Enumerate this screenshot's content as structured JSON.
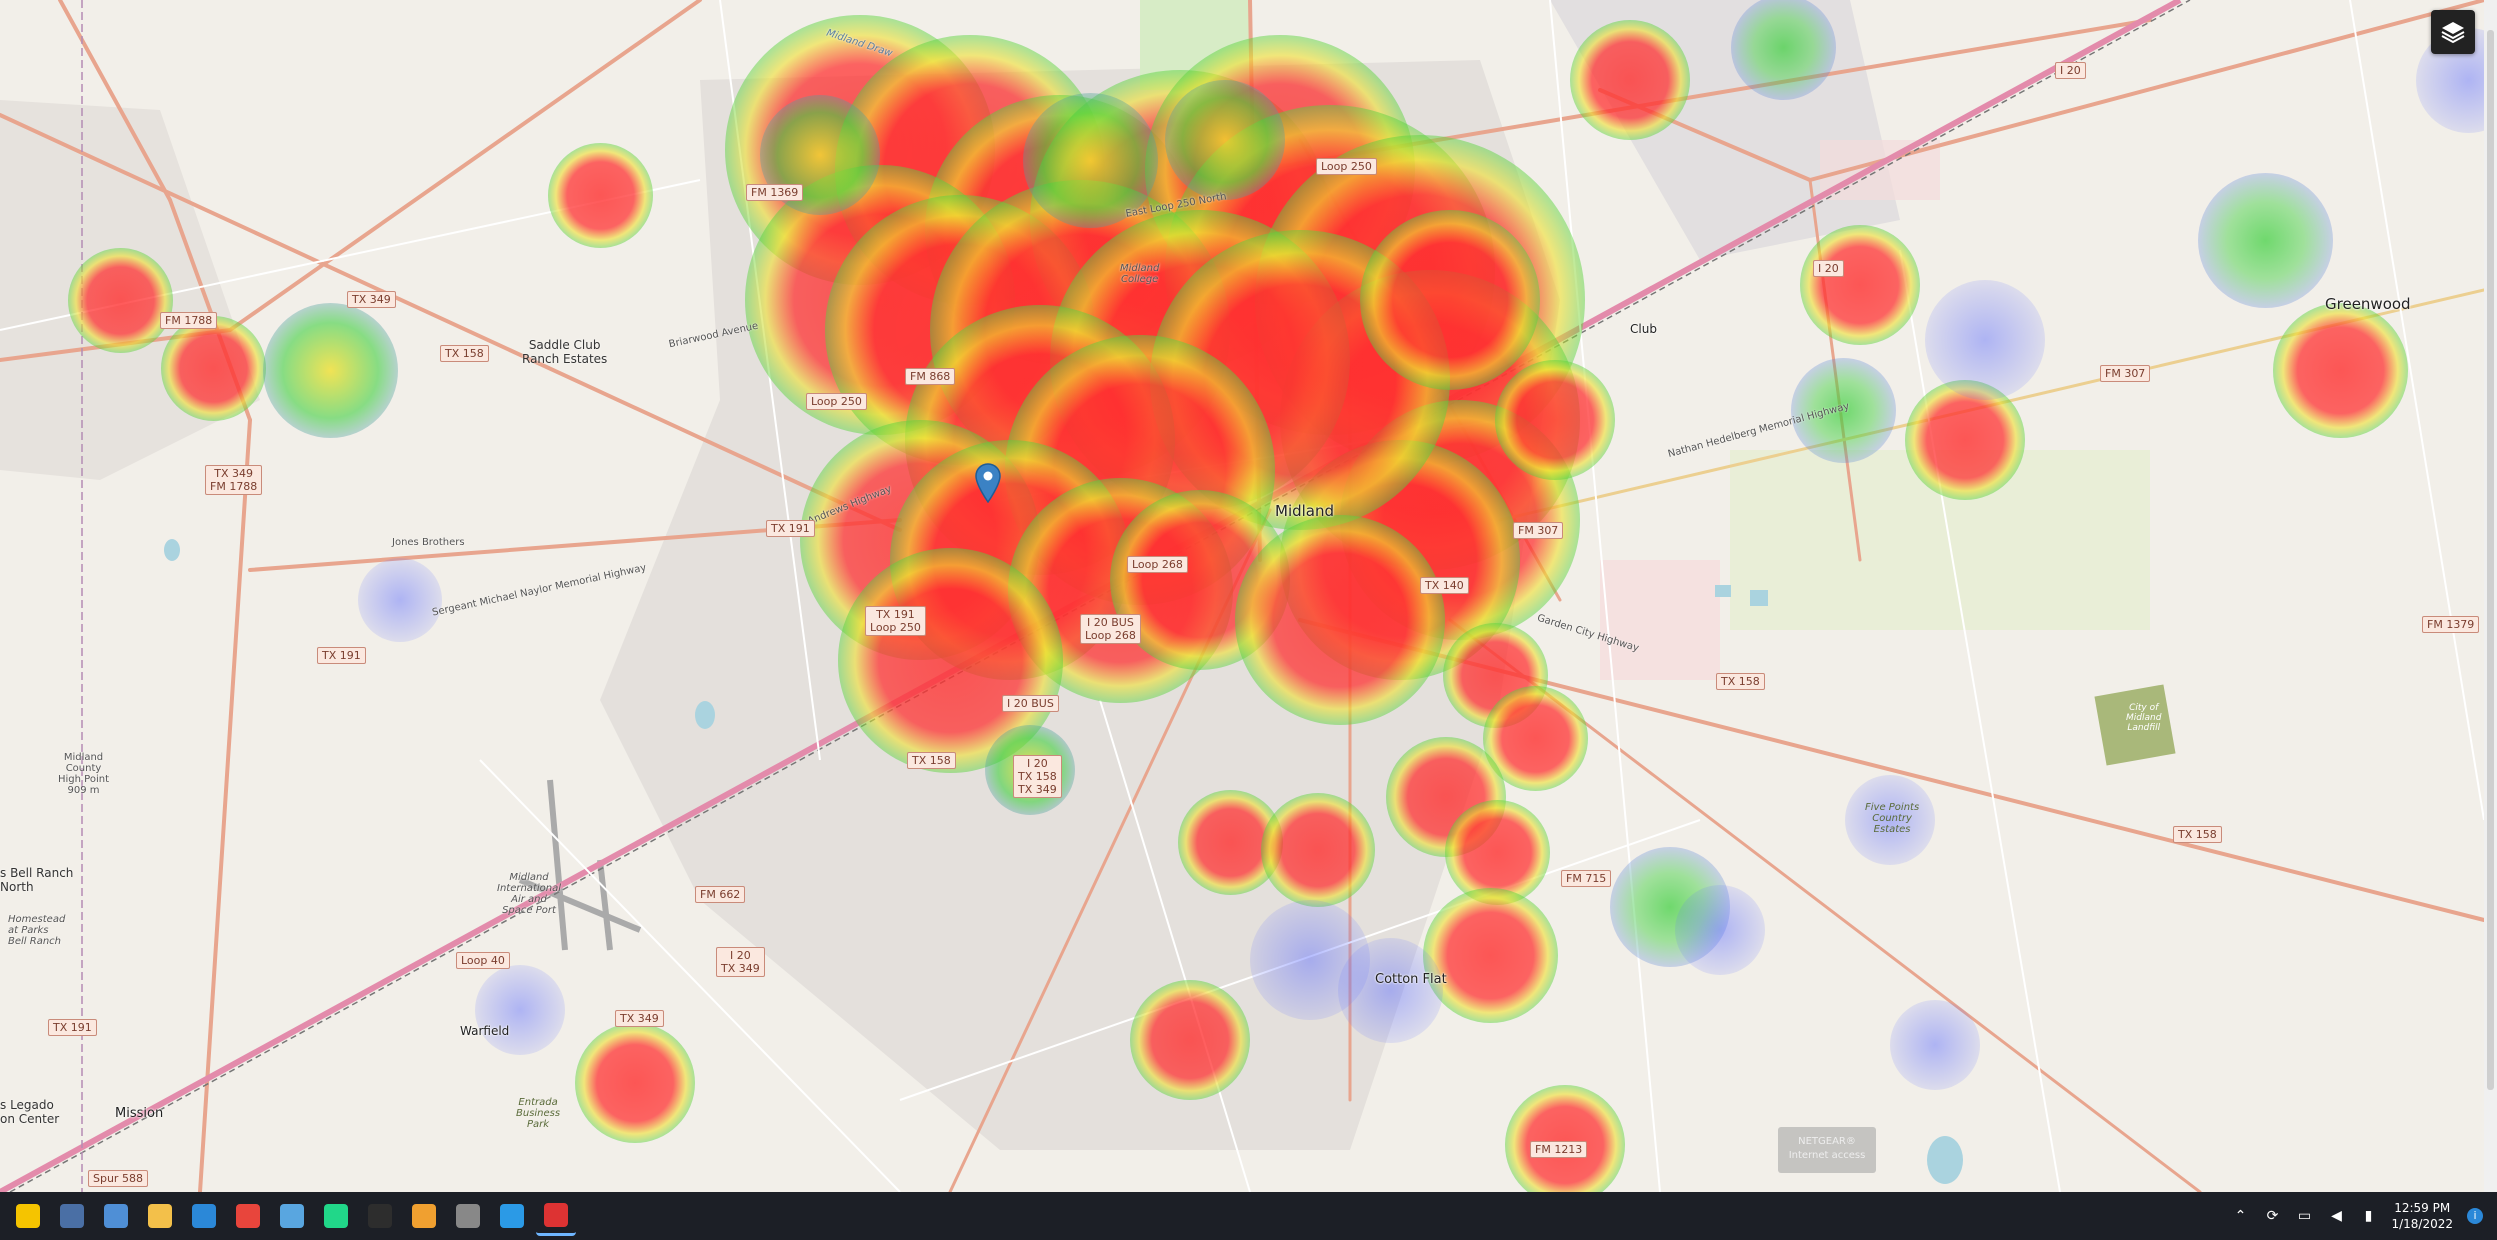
{
  "map": {
    "places": {
      "midland": "Midland",
      "greenwood": "Greenwood",
      "cotton_flat": "Cotton Flat",
      "warfield": "Warfield",
      "mission": "Mission",
      "saddle_club": "Saddle Club\nRanch Estates",
      "jones_brothers": "Jones Brothers",
      "bell_ranch": "s Bell Ranch\nNorth",
      "homestead": "Homestead\nat Parks\nBell Ranch",
      "legado": "s Legado\non Center",
      "midland_college": "Midland\nCollege",
      "airport": "Midland\nInternational\nAir and\nSpace Port",
      "high_point": "Midland\nCounty\nHigh Point\n909 m",
      "five_points": "Five Points\nCountry\nEstates",
      "city_landfill": "City of\nMidland\nLandfill",
      "entrada": "Entrada\nBusiness\nPark",
      "club": "Club",
      "midland_draw": "Midland Draw"
    },
    "shields": {
      "fm1369": "FM 1369",
      "loop250_n": "Loop 250",
      "tx349_w": "TX 349",
      "fm1788": "FM 1788",
      "tx349_fm1788": "TX 349\nFM 1788",
      "tx158_w": "TX 158",
      "fm868": "FM 868",
      "loop250_w": "Loop 250",
      "tx191_c": "TX 191",
      "tx191_w": "TX 191",
      "tx191_loop250": "TX 191\nLoop 250",
      "loop268": "Loop 268",
      "i20bus_loop268": "I 20 BUS\nLoop 268",
      "i20bus": "I 20 BUS",
      "tx158_c": "TX 158",
      "i20_tx158_tx349": "I 20\nTX 158\nTX 349",
      "tx307": "FM 307",
      "fm307_e": "FM 307",
      "tx140": "TX 140",
      "tx158_e": "TX 158",
      "tx158_far": "TX 158",
      "fm715": "FM 715",
      "fm662": "FM 662",
      "i20_tx349": "I 20\nTX 349",
      "tx349_s": "TX 349",
      "loop40": "Loop 40",
      "tx191_sw": "TX 191",
      "spur588": "Spur 588",
      "fm1213": "FM 1213",
      "fm1379": "FM 1379",
      "i20_ne": "I 20",
      "i20_e": "I 20"
    },
    "road_names": {
      "andrews": "Andrews Highway",
      "loop250n": "East Loop 250 North",
      "nathan": "Nathan Hedelberg Memorial Highway",
      "sgt": "Sergeant Michael Naylor Memorial Highway",
      "garden_city": "Garden City Highway",
      "briarwood": "Briarwood Avenue"
    },
    "marker_icon": "location-pin-icon",
    "layer_button_icon": "layers-icon",
    "watermark_line1": "NETGEAR®",
    "watermark_line2": "Internet access",
    "heat_colors": {
      "high": "#ff3030",
      "mid": "#f0e030",
      "low": "#40d040",
      "faint": "#6070ff"
    }
  },
  "taskbar": {
    "apps": [
      {
        "name": "start-sticky-notes",
        "color": "#f5c400"
      },
      {
        "name": "calculator",
        "color": "#4a6fa5"
      },
      {
        "name": "photos",
        "color": "#4f8fd6"
      },
      {
        "name": "file-explorer",
        "color": "#f3c04a"
      },
      {
        "name": "mail",
        "color": "#2b88d8"
      },
      {
        "name": "chrome",
        "color": "#e8453c"
      },
      {
        "name": "notepad",
        "color": "#59a6e0"
      },
      {
        "name": "pycharm",
        "color": "#21d789"
      },
      {
        "name": "terminal",
        "color": "#2d2d2d"
      },
      {
        "name": "git-tool",
        "color": "#f0a030"
      },
      {
        "name": "settings-app",
        "color": "#888888"
      },
      {
        "name": "vscode",
        "color": "#2b9ae6"
      },
      {
        "name": "active-app",
        "color": "#d33"
      }
    ],
    "time": "12:59 PM",
    "date": "1/18/2022"
  }
}
